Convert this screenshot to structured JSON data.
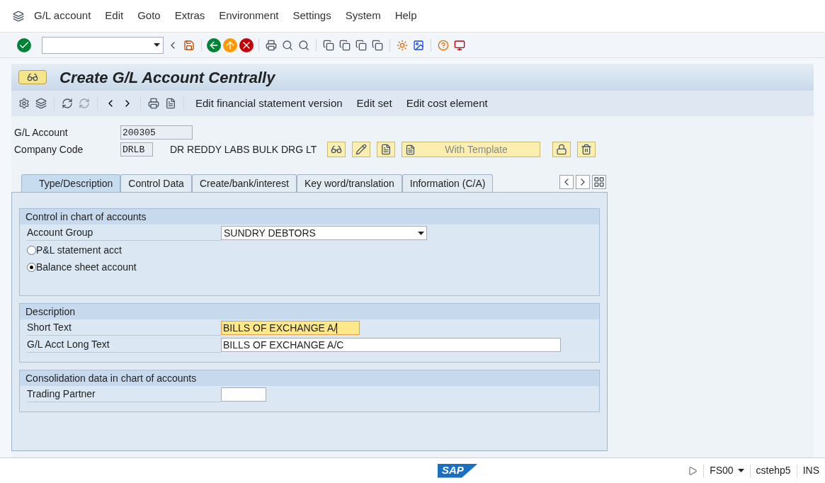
{
  "menu_bar": {
    "items": [
      "G/L account",
      "Edit",
      "Goto",
      "Extras",
      "Environment",
      "Settings",
      "System",
      "Help"
    ]
  },
  "title": "Create G/L Account Centrally",
  "app_toolbar": {
    "buttons": [
      "Edit financial statement version",
      "Edit set",
      "Edit cost element"
    ]
  },
  "header": {
    "gl_account": {
      "label": "G/L Account",
      "value": "200305"
    },
    "company_code": {
      "label": "Company Code",
      "value": "DRLB",
      "name": "DR REDDY LABS BULK DRG LT"
    },
    "template_button": "With Template"
  },
  "tabs": [
    {
      "label": "Type/Description",
      "selected": true
    },
    {
      "label": "Control Data",
      "selected": false
    },
    {
      "label": "Create/bank/interest",
      "selected": false
    },
    {
      "label": "Key word/translation",
      "selected": false
    },
    {
      "label": "Information (C/A)",
      "selected": false
    }
  ],
  "groups": [
    {
      "title": "Control in chart of accounts",
      "rows": [
        {
          "kind": "dropdown",
          "label": "Account Group",
          "value": "SUNDRY DEBTORS"
        },
        {
          "kind": "radio",
          "label": "P&L statement acct",
          "selected": false
        },
        {
          "kind": "radio",
          "label": "Balance sheet account",
          "selected": true
        }
      ]
    },
    {
      "title": "Description",
      "rows": [
        {
          "kind": "field",
          "label": "Short Text",
          "value": "BILLS OF EXCHANGE A/",
          "focused": true
        },
        {
          "kind": "field",
          "label": "G/L Acct Long Text",
          "value": "BILLS OF EXCHANGE A/C",
          "focused": false
        }
      ]
    },
    {
      "title": "Consolidation data in chart of accounts",
      "rows": [
        {
          "kind": "field",
          "label": "Trading Partner",
          "value": "",
          "focused": false,
          "short": true
        }
      ]
    }
  ],
  "status_bar": {
    "logo": "SAP",
    "transaction": "FS00",
    "server": "cstehp5",
    "mode": "INS"
  }
}
